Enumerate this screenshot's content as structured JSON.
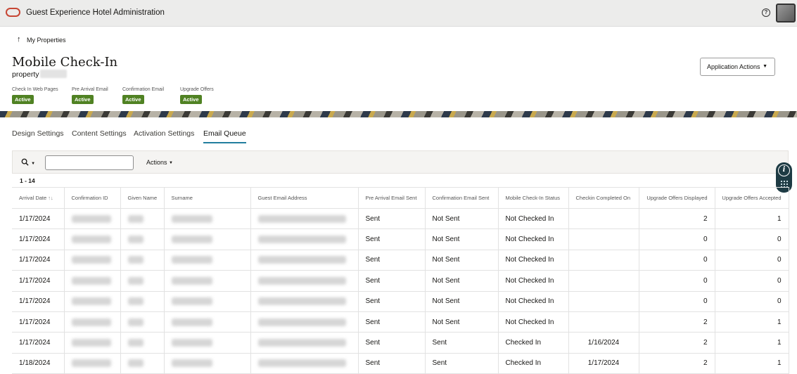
{
  "header": {
    "app_title": "Guest Experience Hotel Administration",
    "icons": {
      "logo": "oracle-logo-icon",
      "help": "help-icon",
      "avatar": "user-avatar"
    }
  },
  "nav": {
    "back_label": "My Properties"
  },
  "page": {
    "title": "Mobile Check-In",
    "property_label": "property"
  },
  "statuses": [
    {
      "label": "Check In Web Pages",
      "badge": "Active"
    },
    {
      "label": "Pre Arrival Email",
      "badge": "Active"
    },
    {
      "label": "Confirmation Email",
      "badge": "Active"
    },
    {
      "label": "Upgrade Offers",
      "badge": "Active"
    }
  ],
  "application_actions_label": "Application Actions",
  "tabs": [
    {
      "label": "Design Settings",
      "active": false
    },
    {
      "label": "Content Settings",
      "active": false
    },
    {
      "label": "Activation Settings",
      "active": false
    },
    {
      "label": "Email Queue",
      "active": true
    }
  ],
  "toolbar": {
    "actions_label": "Actions",
    "search_value": ""
  },
  "table": {
    "range": "1 - 14",
    "columns": [
      "Arrival Date",
      "Confirmation ID",
      "Given Name",
      "Surname",
      "Guest Email Address",
      "Pre Arrival Email Sent",
      "Confirmation Email Sent",
      "Mobile Check-In Status",
      "Checkin Completed On",
      "Upgrade Offers Displayed",
      "Upgrade Offers Accepted"
    ],
    "rows": [
      {
        "arrival": "1/17/2024",
        "pre": "Sent",
        "conf": "Not Sent",
        "status": "Not Checked In",
        "completed": "",
        "displayed": "2",
        "accepted": "1"
      },
      {
        "arrival": "1/17/2024",
        "pre": "Sent",
        "conf": "Not Sent",
        "status": "Not Checked In",
        "completed": "",
        "displayed": "0",
        "accepted": "0"
      },
      {
        "arrival": "1/17/2024",
        "pre": "Sent",
        "conf": "Not Sent",
        "status": "Not Checked In",
        "completed": "",
        "displayed": "0",
        "accepted": "0"
      },
      {
        "arrival": "1/17/2024",
        "pre": "Sent",
        "conf": "Not Sent",
        "status": "Not Checked In",
        "completed": "",
        "displayed": "0",
        "accepted": "0"
      },
      {
        "arrival": "1/17/2024",
        "pre": "Sent",
        "conf": "Not Sent",
        "status": "Not Checked In",
        "completed": "",
        "displayed": "0",
        "accepted": "0"
      },
      {
        "arrival": "1/17/2024",
        "pre": "Sent",
        "conf": "Not Sent",
        "status": "Not Checked In",
        "completed": "",
        "displayed": "2",
        "accepted": "1"
      },
      {
        "arrival": "1/17/2024",
        "pre": "Sent",
        "conf": "Sent",
        "status": "Checked In",
        "completed": "1/16/2024",
        "displayed": "2",
        "accepted": "1"
      },
      {
        "arrival": "1/18/2024",
        "pre": "Sent",
        "conf": "Sent",
        "status": "Checked In",
        "completed": "1/17/2024",
        "displayed": "2",
        "accepted": "1"
      }
    ]
  },
  "colors": {
    "accent": "#227e9e",
    "badge": "#508223",
    "brand": "#c74634"
  }
}
